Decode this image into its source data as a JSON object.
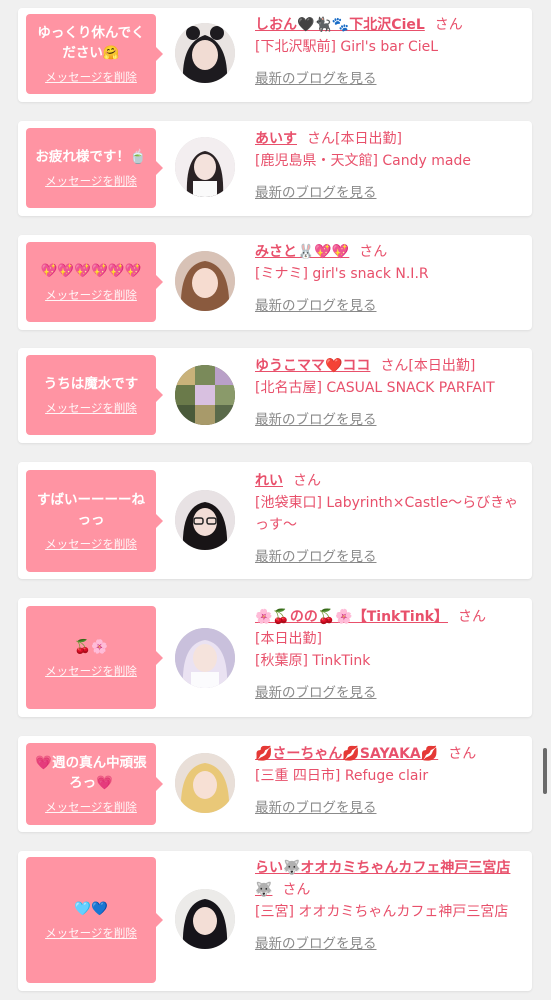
{
  "colors": {
    "bubble": "#ff94a3",
    "accent": "#e8506b",
    "link_gray": "#8a8a8a",
    "background": "#f0f0f0"
  },
  "cards": [
    {
      "message": "ゆっくり休んでください🤗",
      "delete_label": "メッセージを削除",
      "name": "しおん🖤🐈‍⬛🐾下北沢CieL",
      "honorific": "さん",
      "lines": [
        "[下北沢駅前] Girl's bar CieL"
      ],
      "blog_label": "最新のブログを見る"
    },
    {
      "message": "お疲れ様です！🍵",
      "delete_label": "メッセージを削除",
      "name": "あいす",
      "honorific": "さん[本日出勤]",
      "lines": [
        "[鹿児島県・天文館] Candy made"
      ],
      "blog_label": "最新のブログを見る"
    },
    {
      "message": "💖💖💖💖💖💖",
      "delete_label": "メッセージを削除",
      "name": "みさと🐰💖💖",
      "honorific": "さん",
      "lines": [
        "[ミナミ] girl's snack N.I.R"
      ],
      "blog_label": "最新のブログを見る"
    },
    {
      "message": "うちは魔水です",
      "delete_label": "メッセージを削除",
      "name": "ゆうこママ❤️ココ",
      "honorific": "さん[本日出勤]",
      "lines": [
        "[北名古屋] CASUAL SNACK PARFAIT"
      ],
      "blog_label": "最新のブログを見る"
    },
    {
      "message": "すばいーーーーねっっ",
      "delete_label": "メッセージを削除",
      "name": "れい",
      "honorific": "さん",
      "lines": [
        "[池袋東口] Labyrinth×Castle〜らびきゃっす〜"
      ],
      "blog_label": "最新のブログを見る"
    },
    {
      "message": "🍒🌸",
      "delete_label": "メッセージを削除",
      "name": "🌸🍒のの🍒🌸【TinkTink】",
      "honorific": "さん",
      "lines": [
        "[本日出勤]",
        "[秋葉原] TinkTink"
      ],
      "blog_label": "最新のブログを見る"
    },
    {
      "message": "💗週の真ん中頑張ろっ💗",
      "delete_label": "メッセージを削除",
      "name": "💋さーちゃん💋SAYAKA💋",
      "honorific": "さん",
      "lines": [
        "[三重 四日市] Refuge clair"
      ],
      "blog_label": "最新のブログを見る"
    },
    {
      "message": "🩵💙",
      "delete_label": "メッセージを削除",
      "name": "らい🐺オオカミちゃんカフェ神戸三宮店🐺",
      "honorific": "さん",
      "lines": [
        "[三宮] オオカミちゃんカフェ神戸三宮店"
      ],
      "blog_label": "最新のブログを見る"
    }
  ]
}
